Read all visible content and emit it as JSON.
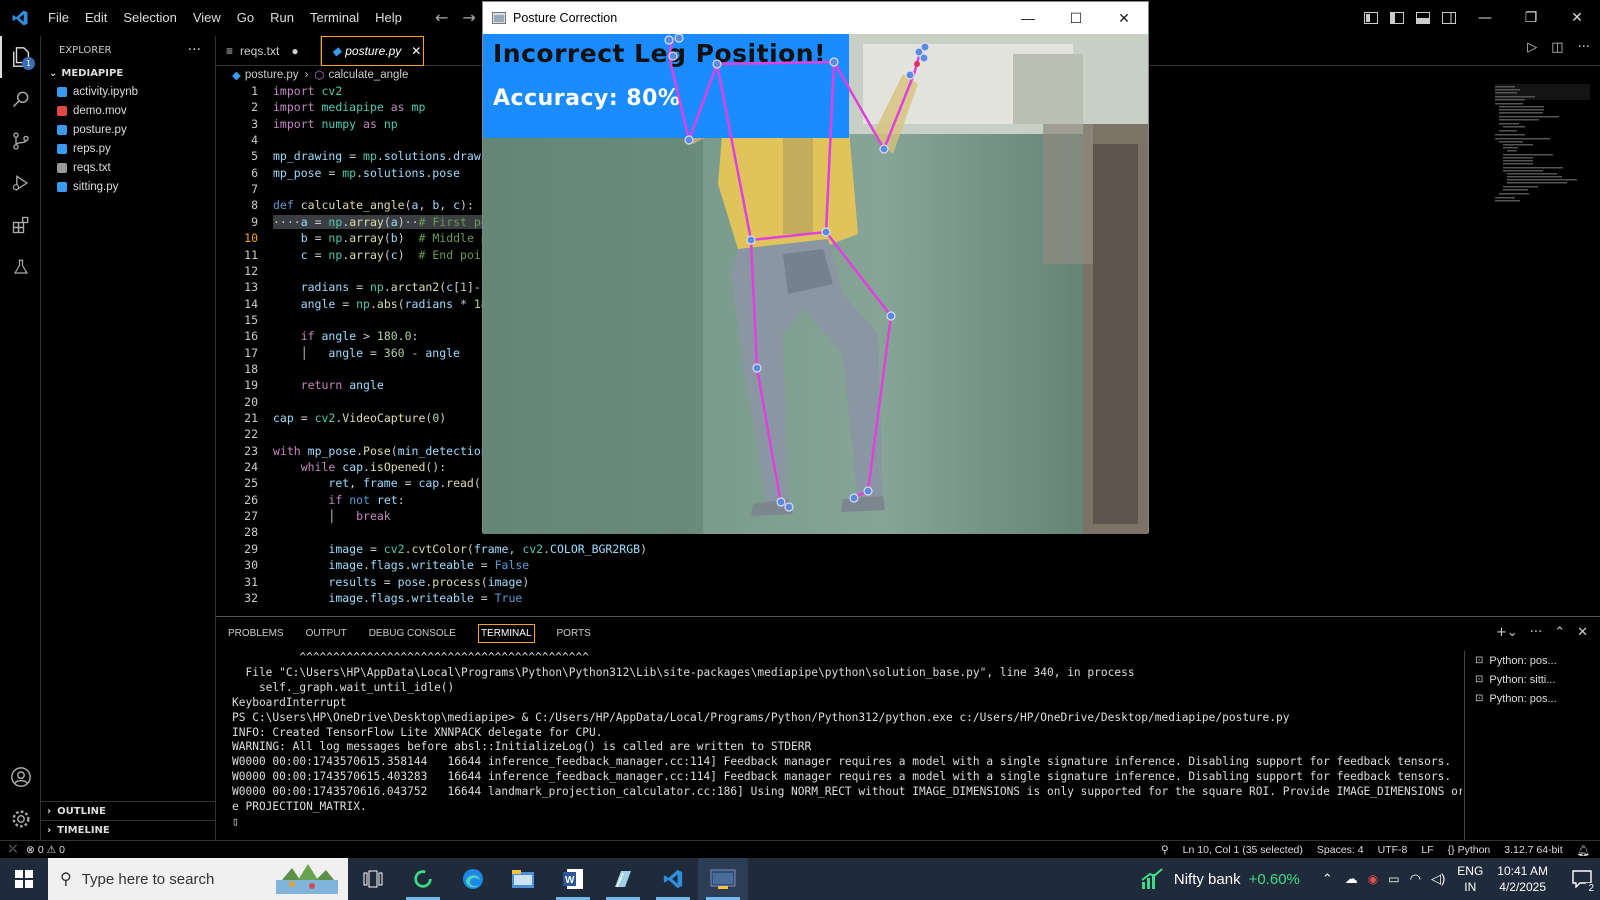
{
  "menu": [
    "File",
    "Edit",
    "Selection",
    "View",
    "Go",
    "Run",
    "Terminal",
    "Help"
  ],
  "sidebar": {
    "title": "EXPLORER",
    "folder": "MEDIAPIPE",
    "files": [
      {
        "name": "activity.ipynb",
        "color": "#3b9bf0"
      },
      {
        "name": "demo.mov",
        "color": "#e04848"
      },
      {
        "name": "posture.py",
        "color": "#3b9bf0"
      },
      {
        "name": "reps.py",
        "color": "#3b9bf0"
      },
      {
        "name": "reqs.txt",
        "color": "#999999"
      },
      {
        "name": "sitting.py",
        "color": "#3b9bf0"
      }
    ],
    "outline": "OUTLINE",
    "timeline": "TIMELINE"
  },
  "tabs": [
    {
      "label": "reqs.txt",
      "modified": "●"
    },
    {
      "label": "posture.py",
      "close": "✕"
    }
  ],
  "breadcrumb": {
    "file": "posture.py",
    "symbol": "calculate_angle",
    "sep": "›"
  },
  "code": {
    "current_line": 10,
    "lines": [
      {
        "n": "1"
      },
      {
        "n": "2"
      },
      {
        "n": "3"
      },
      {
        "n": "4"
      },
      {
        "n": "5"
      },
      {
        "n": "6"
      },
      {
        "n": "7"
      },
      {
        "n": "8"
      },
      {
        "n": "9"
      },
      {
        "n": "10"
      },
      {
        "n": "11"
      },
      {
        "n": "12"
      },
      {
        "n": "13"
      },
      {
        "n": "14"
      },
      {
        "n": "15"
      },
      {
        "n": "16"
      },
      {
        "n": "17"
      },
      {
        "n": "18"
      },
      {
        "n": "19"
      },
      {
        "n": "20"
      },
      {
        "n": "21"
      },
      {
        "n": "22"
      },
      {
        "n": "23"
      },
      {
        "n": "24"
      },
      {
        "n": "25"
      },
      {
        "n": "26"
      },
      {
        "n": "27"
      },
      {
        "n": "28"
      },
      {
        "n": "29"
      },
      {
        "n": "30"
      },
      {
        "n": "31"
      },
      {
        "n": "32"
      }
    ]
  },
  "panel": {
    "tabs": [
      "PROBLEMS",
      "OUTPUT",
      "DEBUG CONSOLE",
      "TERMINAL",
      "PORTS"
    ],
    "active_tab": "TERMINAL",
    "terminal_lines": [
      "          ^^^^^^^^^^^^^^^^^^^^^^^^^^^^^^^^^^^^^^^^^^^",
      "  File \"C:\\Users\\HP\\AppData\\Local\\Programs\\Python\\Python312\\Lib\\site-packages\\mediapipe\\python\\solution_base.py\", line 340, in process",
      "    self._graph.wait_until_idle()",
      "KeyboardInterrupt",
      "PS C:\\Users\\HP\\OneDrive\\Desktop\\mediapipe> & C:/Users/HP/AppData/Local/Programs/Python/Python312/python.exe c:/Users/HP/OneDrive/Desktop/mediapipe/posture.py",
      "INFO: Created TensorFlow Lite XNNPACK delegate for CPU.",
      "WARNING: All log messages before absl::InitializeLog() is called are written to STDERR",
      "W0000 00:00:1743570615.358144   16644 inference_feedback_manager.cc:114] Feedback manager requires a model with a single signature inference. Disabling support for feedback tensors.",
      "W0000 00:00:1743570615.403283   16644 inference_feedback_manager.cc:114] Feedback manager requires a model with a single signature inference. Disabling support for feedback tensors.",
      "W0000 00:00:1743570616.043752   16644 landmark_projection_calculator.cc:186] Using NORM_RECT without IMAGE_DIMENSIONS is only supported for the square ROI. Provide IMAGE_DIMENSIONS or us",
      "e PROJECTION_MATRIX.",
      "▯"
    ],
    "terminals": [
      "Python: pos...",
      "Python: sitti...",
      "Python: pos..."
    ]
  },
  "statusbar": {
    "errors": "0",
    "warnings": "0",
    "position": "Ln 10, Col 1 (35 selected)",
    "spaces": "Spaces: 4",
    "encoding": "UTF-8",
    "eol": "LF",
    "language": "Python",
    "interpreter": "3.12.7 64-bit"
  },
  "posture_window": {
    "title": "Posture Correction",
    "status_text": "Incorrect Leg Position!",
    "accuracy_text": "Accuracy: 80%",
    "landmark_color": "#e040e0",
    "banner_color": "#1a8cff"
  },
  "taskbar": {
    "search_placeholder": "Type here to search",
    "widget_name": "Nifty bank",
    "widget_change": "+0.60%",
    "lang_top": "ENG",
    "lang_bottom": "IN",
    "time": "10:41 AM",
    "date": "4/2/2025",
    "notifications": "2"
  },
  "colors": {
    "accent": "#f6a623",
    "widget_positive": "#3ddc84"
  }
}
